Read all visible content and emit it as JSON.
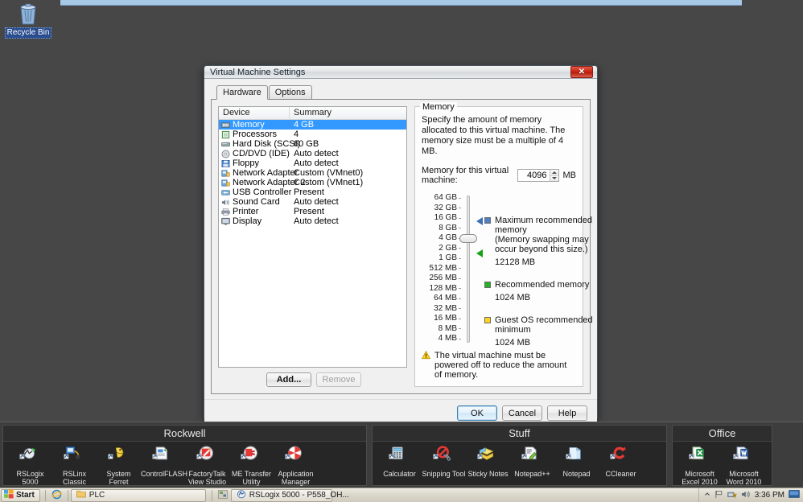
{
  "desktop": {
    "recycle_bin_label": "Recycle Bin"
  },
  "dialog": {
    "title": "Virtual Machine Settings",
    "close_label": "✕",
    "tabs": [
      {
        "label": "Hardware",
        "active": true
      },
      {
        "label": "Options",
        "active": false
      }
    ],
    "device_table": {
      "columns": [
        "Device",
        "Summary"
      ],
      "rows": [
        {
          "icon": "memory-icon",
          "device": "Memory",
          "summary": "4 GB",
          "selected": true
        },
        {
          "icon": "processor-icon",
          "device": "Processors",
          "summary": "4",
          "selected": false
        },
        {
          "icon": "harddisk-icon",
          "device": "Hard Disk (SCSI)",
          "summary": "60 GB",
          "selected": false
        },
        {
          "icon": "cddvd-icon",
          "device": "CD/DVD (IDE)",
          "summary": "Auto detect",
          "selected": false
        },
        {
          "icon": "floppy-icon",
          "device": "Floppy",
          "summary": "Auto detect",
          "selected": false
        },
        {
          "icon": "network-icon",
          "device": "Network Adapter",
          "summary": "Custom (VMnet0)",
          "selected": false
        },
        {
          "icon": "network-icon",
          "device": "Network Adapter 2",
          "summary": "Custom (VMnet1)",
          "selected": false
        },
        {
          "icon": "usb-icon",
          "device": "USB Controller",
          "summary": "Present",
          "selected": false
        },
        {
          "icon": "soundcard-icon",
          "device": "Sound Card",
          "summary": "Auto detect",
          "selected": false
        },
        {
          "icon": "printer-icon",
          "device": "Printer",
          "summary": "Present",
          "selected": false
        },
        {
          "icon": "display-icon",
          "device": "Display",
          "summary": "Auto detect",
          "selected": false
        }
      ]
    },
    "add_button": "Add...",
    "remove_button": "Remove",
    "memory": {
      "group_title": "Memory",
      "description": "Specify the amount of memory allocated to this virtual machine. The memory size must be a multiple of 4 MB.",
      "input_label": "Memory for this virtual machine:",
      "input_value": "4096",
      "input_unit": "MB",
      "scale_labels": [
        "64 GB",
        "32 GB",
        "16 GB",
        "8 GB",
        "4 GB",
        "2 GB",
        "1 GB",
        "512 MB",
        "256 MB",
        "128 MB",
        "64 MB",
        "32 MB",
        "16 MB",
        "8 MB",
        "4 MB"
      ],
      "thumb_label": "4 GB",
      "legend": [
        {
          "swatch_color": "#4f7fc4",
          "title": "Maximum recommended memory",
          "note": "(Memory swapping may occur beyond this size.)",
          "value": "12128 MB"
        },
        {
          "swatch_color": "#22b222",
          "title": "Recommended memory",
          "note": "",
          "value": "1024 MB"
        },
        {
          "swatch_color": "#ffd21e",
          "title": "Guest OS recommended minimum",
          "note": "",
          "value": "1024 MB"
        }
      ],
      "warning": "The virtual machine must be powered off to reduce the amount of memory."
    },
    "footer_buttons": [
      {
        "label": "OK",
        "default": true,
        "disabled": false
      },
      {
        "label": "Cancel",
        "default": false,
        "disabled": false
      },
      {
        "label": "Help",
        "default": false,
        "disabled": false
      }
    ]
  },
  "docks": [
    {
      "title": "Rockwell",
      "items": [
        {
          "icon": "rslogix-icon",
          "label": "RSLogix 5000"
        },
        {
          "icon": "rslinx-icon",
          "label": "RSLinx Classic"
        },
        {
          "icon": "systemferret-icon",
          "label": "System Ferret"
        },
        {
          "icon": "controlflash-icon",
          "label": "ControlFLASH"
        },
        {
          "icon": "factorytalk-icon",
          "label": "FactoryTalk View Studio"
        },
        {
          "icon": "metransfer-icon",
          "label": "ME Transfer Utility"
        },
        {
          "icon": "appmanager-icon",
          "label": "Application Manager"
        }
      ]
    },
    {
      "title": "Stuff",
      "items": [
        {
          "icon": "calculator-icon",
          "label": "Calculator"
        },
        {
          "icon": "snipping-icon",
          "label": "Snipping Tool"
        },
        {
          "icon": "stickynotes-icon",
          "label": "Sticky Notes"
        },
        {
          "icon": "notepadpp-icon",
          "label": "Notepad++"
        },
        {
          "icon": "notepad-icon",
          "label": "Notepad"
        },
        {
          "icon": "ccleaner-icon",
          "label": "CCleaner"
        }
      ]
    },
    {
      "title": "Office",
      "items": [
        {
          "icon": "excel-icon",
          "label": "Microsoft Excel 2010"
        },
        {
          "icon": "word-icon",
          "label": "Microsoft Word 2010"
        }
      ]
    }
  ],
  "taskbar": {
    "start_label": "Start",
    "quicklaunch": [
      {
        "icon": "internet-explorer-icon"
      }
    ],
    "tasks": [
      {
        "icon": "folder-icon",
        "label": "PLC"
      },
      {
        "icon": "rslogix-icon",
        "label": "RSLogix 5000 - P558_OH..."
      }
    ],
    "tray": {
      "icons": [
        "show-hidden-icons",
        "flag-icon",
        "network-warning-icon",
        "volume-icon"
      ],
      "time": "3:36 PM",
      "show_desktop": "show-desktop-icon"
    }
  }
}
